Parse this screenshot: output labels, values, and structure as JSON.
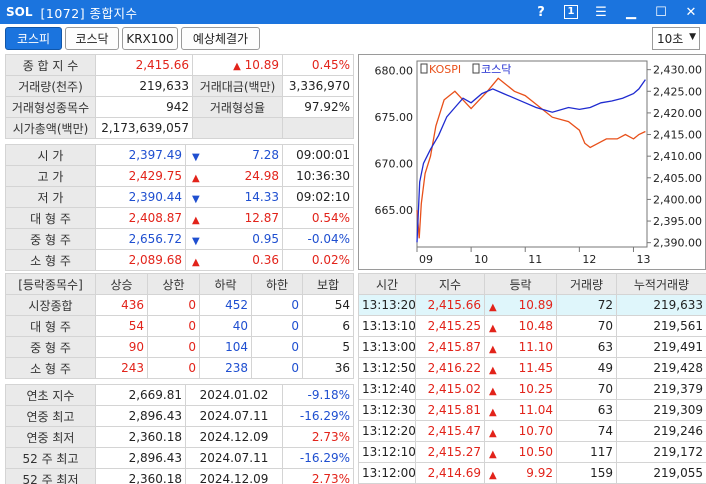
{
  "title": {
    "logo": "SOL",
    "text": "[1072] 종합지수"
  },
  "window_controls": {
    "help": "?",
    "box": "1"
  },
  "tabs": [
    "코스피",
    "코스닥",
    "KRX100",
    "예상체결가"
  ],
  "interval": "10초",
  "summary": {
    "index_label": "종 합 지 수",
    "index_value": "2,415.66",
    "index_change": "10.89",
    "index_rate": "0.45%",
    "volume_label": "거래량(천주)",
    "volume": "219,633",
    "amount_label": "거래대금(백만)",
    "amount": "3,336,970",
    "forming_label": "거래형성종목수",
    "forming_count": "942",
    "forming_rate_label": "거래형성율",
    "forming_rate": "97.92%",
    "cap_label": "시가총액(백만)",
    "cap": "2,173,639,057"
  },
  "prices": [
    {
      "label": "시   가",
      "value": "2,397.49",
      "dir": "dn",
      "change": "7.28",
      "extra": "09:00:01",
      "vcolor": "blue",
      "ecolor": ""
    },
    {
      "label": "고   가",
      "value": "2,429.75",
      "dir": "up",
      "change": "24.98",
      "extra": "10:36:30",
      "vcolor": "red",
      "ecolor": ""
    },
    {
      "label": "저   가",
      "value": "2,390.44",
      "dir": "dn",
      "change": "14.33",
      "extra": "09:02:10",
      "vcolor": "blue",
      "ecolor": ""
    },
    {
      "label": "대 형 주",
      "value": "2,408.87",
      "dir": "up",
      "change": "12.87",
      "extra": "0.54%",
      "vcolor": "red",
      "ecolor": "red"
    },
    {
      "label": "중 형 주",
      "value": "2,656.72",
      "dir": "dn",
      "change": "0.95",
      "extra": "-0.04%",
      "vcolor": "blue",
      "ecolor": "blue"
    },
    {
      "label": "소 형 주",
      "value": "2,089.68",
      "dir": "up",
      "change": "0.36",
      "extra": "0.02%",
      "vcolor": "red",
      "ecolor": "red"
    }
  ],
  "breadth": {
    "headers": [
      "[등락종목수]",
      "상승",
      "상한",
      "하락",
      "하한",
      "보합"
    ],
    "rows": [
      {
        "label": "시장종합",
        "up": "436",
        "upper": "0",
        "down": "452",
        "lower": "0",
        "flat": "54"
      },
      {
        "label": "대 형 주",
        "up": "54",
        "upper": "0",
        "down": "40",
        "lower": "0",
        "flat": "6"
      },
      {
        "label": "중 형 주",
        "up": "90",
        "upper": "0",
        "down": "104",
        "lower": "0",
        "flat": "5"
      },
      {
        "label": "소 형 주",
        "up": "243",
        "upper": "0",
        "down": "238",
        "lower": "0",
        "flat": "36"
      }
    ]
  },
  "yearly": [
    {
      "label": "연초  지수",
      "value": "2,669.81",
      "date": "2024.01.02",
      "rate": "-9.18%",
      "color": "blue"
    },
    {
      "label": "연중  최고",
      "value": "2,896.43",
      "date": "2024.07.11",
      "rate": "-16.29%",
      "color": "blue"
    },
    {
      "label": "연중  최저",
      "value": "2,360.18",
      "date": "2024.12.09",
      "rate": "2.73%",
      "color": "red"
    },
    {
      "label": "52 주 최고",
      "value": "2,896.43",
      "date": "2024.07.11",
      "rate": "-16.29%",
      "color": "blue"
    },
    {
      "label": "52 주 최저",
      "value": "2,360.18",
      "date": "2024.12.09",
      "rate": "2.73%",
      "color": "red"
    }
  ],
  "ticks": {
    "headers": [
      "시간",
      "지수",
      "등락",
      "거래량",
      "누적거래량"
    ],
    "rows": [
      {
        "time": "13:13:20",
        "index": "2,415.66",
        "change": "10.89",
        "vol": "72",
        "cum": "219,633"
      },
      {
        "time": "13:13:10",
        "index": "2,415.25",
        "change": "10.48",
        "vol": "70",
        "cum": "219,561"
      },
      {
        "time": "13:13:00",
        "index": "2,415.87",
        "change": "11.10",
        "vol": "63",
        "cum": "219,491"
      },
      {
        "time": "13:12:50",
        "index": "2,416.22",
        "change": "11.45",
        "vol": "49",
        "cum": "219,428"
      },
      {
        "time": "13:12:40",
        "index": "2,415.02",
        "change": "10.25",
        "vol": "70",
        "cum": "219,379"
      },
      {
        "time": "13:12:30",
        "index": "2,415.81",
        "change": "11.04",
        "vol": "63",
        "cum": "219,309"
      },
      {
        "time": "13:12:20",
        "index": "2,415.47",
        "change": "10.70",
        "vol": "74",
        "cum": "219,246"
      },
      {
        "time": "13:12:10",
        "index": "2,415.27",
        "change": "10.50",
        "vol": "117",
        "cum": "219,172"
      },
      {
        "time": "13:12:00",
        "index": "2,414.69",
        "change": "9.92",
        "vol": "159",
        "cum": "219,055"
      }
    ]
  },
  "chart_data": {
    "type": "line",
    "legend": [
      "KOSPI",
      "코스닥"
    ],
    "x_ticks": [
      "09",
      "10",
      "11",
      "12",
      "13"
    ],
    "y_left_ticks": [
      "680.00",
      "675.00",
      "670.00",
      "665.00"
    ],
    "y_right_ticks": [
      "2,430.00",
      "2,425.00",
      "2,420.00",
      "2,415.00",
      "2,410.00",
      "2,405.00",
      "2,400.00",
      "2,395.00",
      "2,390.00"
    ],
    "y_left_range": [
      661,
      681
    ],
    "y_right_range": [
      2389,
      2432
    ],
    "x_range": [
      9.0,
      13.25
    ],
    "series": [
      {
        "name": "KOSPI",
        "axis": "right",
        "color": "#e8501a",
        "points": [
          [
            9.0,
            2397.5
          ],
          [
            9.04,
            2391
          ],
          [
            9.08,
            2399
          ],
          [
            9.15,
            2406
          ],
          [
            9.25,
            2410
          ],
          [
            9.35,
            2417
          ],
          [
            9.5,
            2423
          ],
          [
            9.7,
            2425
          ],
          [
            9.85,
            2423
          ],
          [
            10.0,
            2421
          ],
          [
            10.3,
            2425
          ],
          [
            10.5,
            2428
          ],
          [
            10.6,
            2427
          ],
          [
            10.8,
            2425
          ],
          [
            11.0,
            2424
          ],
          [
            11.2,
            2422
          ],
          [
            11.5,
            2419
          ],
          [
            11.8,
            2418
          ],
          [
            12.0,
            2416
          ],
          [
            12.1,
            2413
          ],
          [
            12.2,
            2412
          ],
          [
            12.35,
            2413
          ],
          [
            12.5,
            2414
          ],
          [
            12.7,
            2414
          ],
          [
            12.85,
            2415
          ],
          [
            13.0,
            2414
          ],
          [
            13.1,
            2415
          ],
          [
            13.22,
            2415.7
          ]
        ]
      },
      {
        "name": "코스닥",
        "axis": "left",
        "color": "#1f2bd0",
        "points": [
          [
            9.0,
            661.5
          ],
          [
            9.05,
            668
          ],
          [
            9.12,
            670
          ],
          [
            9.25,
            671.5
          ],
          [
            9.4,
            673
          ],
          [
            9.55,
            675
          ],
          [
            9.7,
            676
          ],
          [
            9.85,
            677
          ],
          [
            10.0,
            676.5
          ],
          [
            10.2,
            677.5
          ],
          [
            10.4,
            678
          ],
          [
            10.6,
            677.5
          ],
          [
            10.8,
            677
          ],
          [
            11.0,
            676.5
          ],
          [
            11.2,
            676
          ],
          [
            11.5,
            675.5
          ],
          [
            11.8,
            676
          ],
          [
            12.0,
            675.8
          ],
          [
            12.2,
            676
          ],
          [
            12.4,
            676.5
          ],
          [
            12.6,
            676.7
          ],
          [
            12.8,
            677
          ],
          [
            13.0,
            677.5
          ],
          [
            13.1,
            678
          ],
          [
            13.22,
            679
          ]
        ]
      }
    ]
  }
}
